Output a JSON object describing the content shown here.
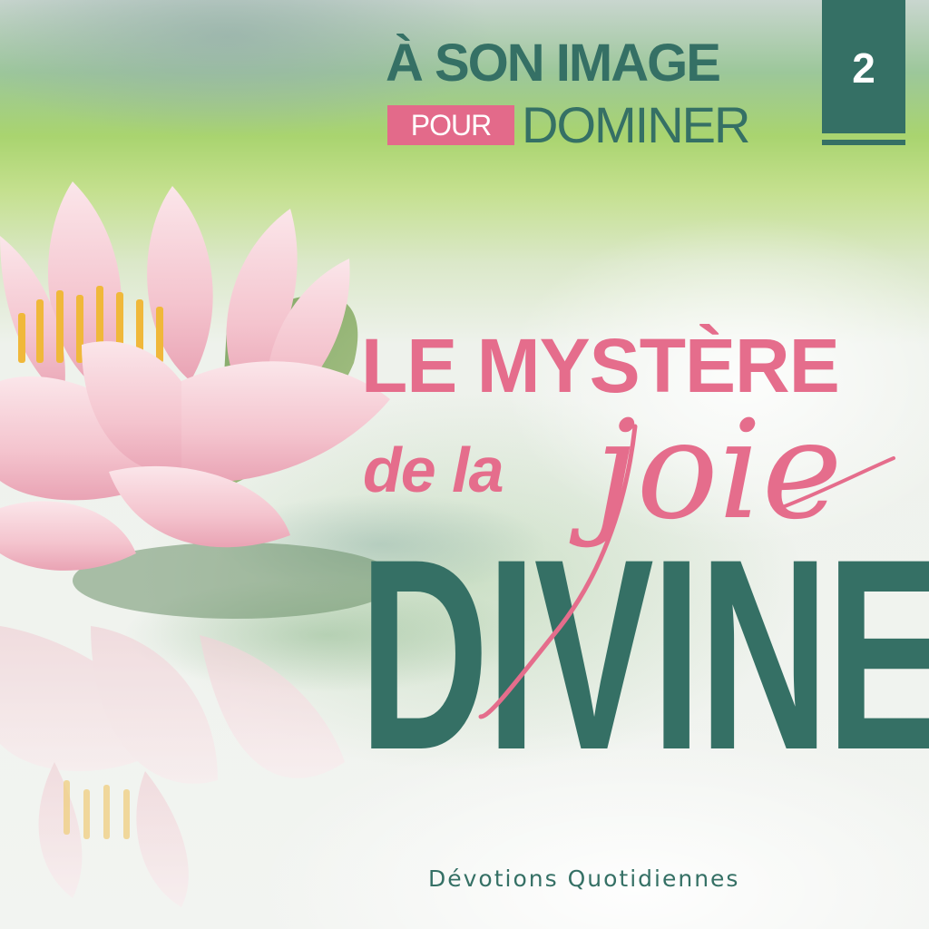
{
  "series": {
    "line1": "À SON IMAGE",
    "pill": "POUR",
    "line2": "DOMINER",
    "volume": "2"
  },
  "title": {
    "line1": "LE MYSTÈRE",
    "line2": "de la",
    "script_word": "joie",
    "main": "DIVINE"
  },
  "subtitle": "Dévotions Quotidiennes",
  "colors": {
    "teal": "#357065",
    "pink": "#e56d8c",
    "pill_pink": "#e36a8a"
  },
  "illustration": "pink-water-lily"
}
